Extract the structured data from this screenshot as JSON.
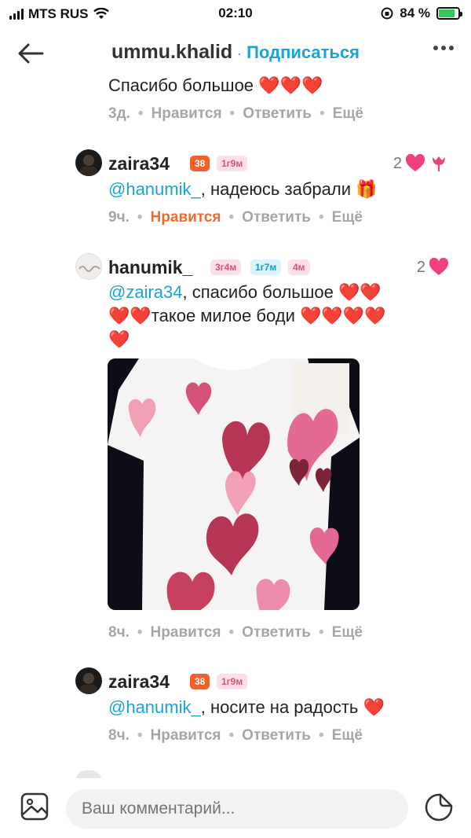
{
  "status": {
    "carrier": "MTS RUS",
    "time": "02:10",
    "battery": "84 %",
    "battery_level": 0.84
  },
  "header": {
    "username": "ummu.khalid",
    "separator": "·",
    "subscribe": "Подписаться"
  },
  "comments": [
    {
      "text": "Спасибо большое ❤️❤️❤️",
      "time": "3д.",
      "like_label": "Нравится",
      "reply_label": "Ответить",
      "more_label": "Ещё"
    },
    {
      "username": "zaira34",
      "badges": [
        "38",
        "1г9м"
      ],
      "likes": "2",
      "mention": "@hanumik_",
      "text": ", надеюсь забрали 🎁",
      "time": "9ч.",
      "like_label": "Нравится",
      "reply_label": "Ответить",
      "more_label": "Ещё"
    },
    {
      "username": "hanumik_",
      "badges": [
        "3г4м",
        "1г7м",
        "4м"
      ],
      "likes": "2",
      "mention": "@zaira34",
      "text": ", спасибо большое ❤️❤️",
      "line2": "❤️❤️такое милое боди ❤️❤️❤️❤️",
      "line3": "❤️",
      "time": "8ч.",
      "like_label": "Нравится",
      "reply_label": "Ответить",
      "more_label": "Ещё"
    },
    {
      "username": "zaira34",
      "badges": [
        "38",
        "1г9м"
      ],
      "mention": "@hanumik_",
      "text": ", носите на радость ❤️",
      "time": "8ч.",
      "like_label": "Нравится",
      "reply_label": "Ответить",
      "more_label": "Ещё"
    }
  ],
  "input": {
    "placeholder": "Ваш комментарий..."
  },
  "colors": {
    "accent": "#1aa3d6",
    "liked": "#ef6a2e",
    "meta": "#a6a6a6",
    "badge_orange": "#f2612c",
    "heart": "#e0192f"
  },
  "icons": [
    "back-arrow-icon",
    "more-dots-icon",
    "heart-icon",
    "tulip-icon",
    "image-icon",
    "sticker-icon"
  ]
}
